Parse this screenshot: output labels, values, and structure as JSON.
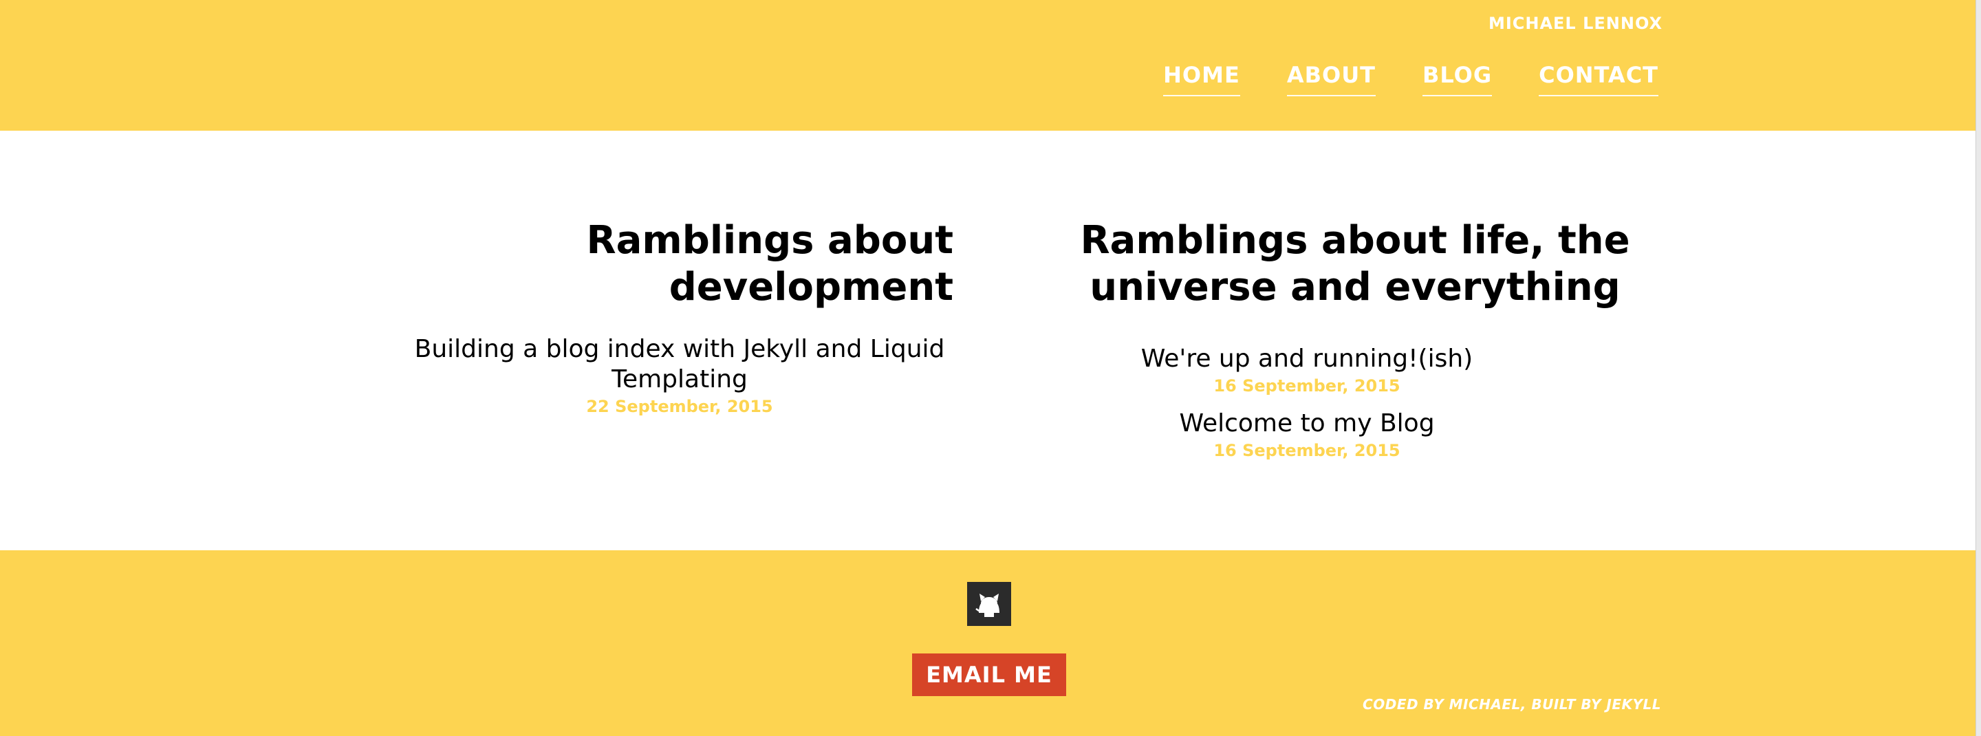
{
  "header": {
    "site_name": "MICHAEL LENNOX",
    "nav": [
      {
        "label": "HOME"
      },
      {
        "label": "ABOUT"
      },
      {
        "label": "BLOG"
      },
      {
        "label": "CONTACT"
      }
    ]
  },
  "sections": [
    {
      "title": "Ramblings about development",
      "posts": [
        {
          "title": "Building a blog index with Jekyll and Liquid Templating",
          "date": "22 September, 2015"
        }
      ]
    },
    {
      "title": "Ramblings about life, the universe and everything",
      "posts": [
        {
          "title": "We're up and running!(ish)",
          "date": "16 September, 2015"
        },
        {
          "title": "Welcome to my Blog",
          "date": "16 September, 2015"
        }
      ]
    }
  ],
  "footer": {
    "icon": "github-icon",
    "email_label": "EMAIL ME",
    "credit": "CODED BY MICHAEL, BUILT BY JEKYLL"
  },
  "colors": {
    "accent": "#fdd451",
    "button": "#d64427",
    "icon_bg": "#2b2b2b"
  }
}
